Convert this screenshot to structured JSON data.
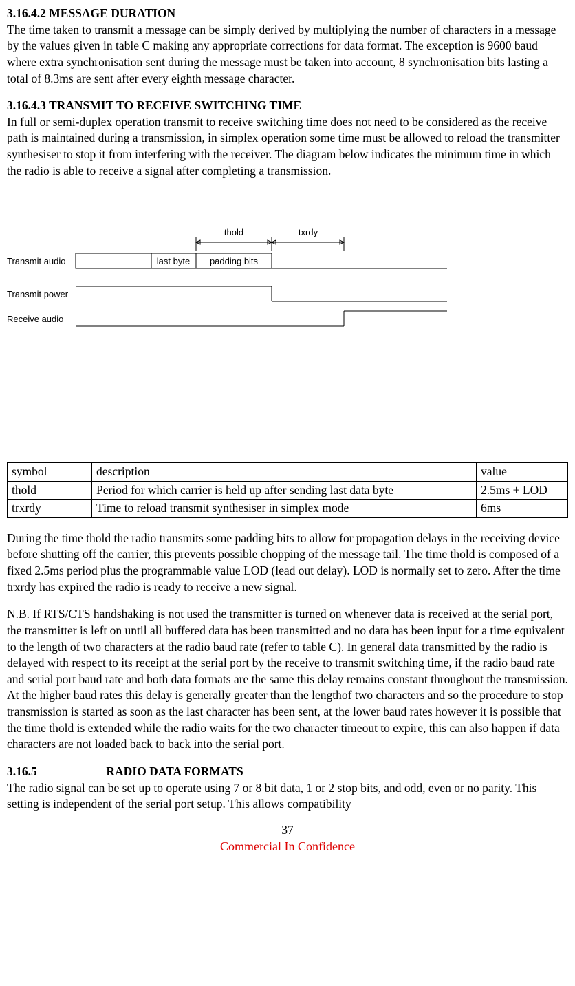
{
  "section_4_2": {
    "heading_number": "3.16.4.2",
    "heading_title": "MESSAGE DURATION",
    "body": "The time taken to transmit a message can be simply derived by multiplying the number of characters in a message by the values given in table C making any appropriate corrections for data format. The exception is 9600 baud where extra synchronisation sent during the message must be taken into account, 8 synchronisation bits lasting a total of 8.3ms are sent after every eighth message character."
  },
  "section_4_3": {
    "heading_number": "3.16.4.3",
    "heading_title": "TRANSMIT TO RECEIVE SWITCHING TIME",
    "body": "In full or semi-duplex operation transmit to receive switching time does not need to be considered as the receive path is maintained during a transmission, in simplex operation some time must be allowed to reload the transmitter synthesiser to stop it from interfering with the receiver. The diagram below indicates the minimum time in which the radio is able to receive a signal after completing a transmission."
  },
  "diagram": {
    "label_thold": "thold",
    "label_txrdy": "txrdy",
    "row_tx_audio": "Transmit audio",
    "seg_last_byte": "last byte",
    "seg_padding": "padding bits",
    "row_tx_power": "Transmit power",
    "row_rx_audio": "Receive audio"
  },
  "table": {
    "headers": {
      "symbol": "symbol",
      "description": "description",
      "value": "value"
    },
    "rows": [
      {
        "symbol": "thold",
        "description": "Period for which carrier is held up after sending last data byte",
        "value": "2.5ms + LOD"
      },
      {
        "symbol": "trxrdy",
        "description": "Time to reload transmit synthesiser in simplex mode",
        "value": "6ms"
      }
    ]
  },
  "para_after_table_1": "During the time thold the radio transmits some padding bits to allow for propagation delays in the receiving device before shutting off the carrier, this prevents possible chopping of the message tail. The time thold is composed of a fixed 2.5ms period plus the programmable value LOD (lead out delay). LOD is normally set to zero.  After the time trxrdy has expired the radio is ready to receive a new signal.",
  "para_after_table_2": "N.B. If RTS/CTS handshaking is not used the transmitter is turned on whenever data is received at the serial port, the transmitter is left on until all buffered data has been transmitted and no data has been input for a time equivalent to the length of two characters at the radio baud rate (refer to table C). In general data transmitted by the radio is delayed with respect to its receipt at the serial port by the receive to transmit switching time, if the radio baud rate and serial port baud rate and both data formats are the same this delay remains constant throughout the transmission. At the higher baud rates this delay is generally greater than the lengthof two characters and so the procedure to stop transmission is started as soon as the last character has been sent, at the lower baud rates however it is possible that the time thold is extended while the radio waits for the two character timeout to expire, this can also happen if data characters are not loaded back to back into the serial port.",
  "section_5": {
    "heading_number": "3.16.5",
    "heading_title": "RADIO DATA FORMATS",
    "body": "The radio signal can be set up to operate using 7 or 8 bit data, 1 or 2 stop bits, and odd, even or no parity. This setting is independent of the serial port setup. This allows compatibility"
  },
  "footer": {
    "page": "37",
    "label": "Commercial In Confidence"
  }
}
